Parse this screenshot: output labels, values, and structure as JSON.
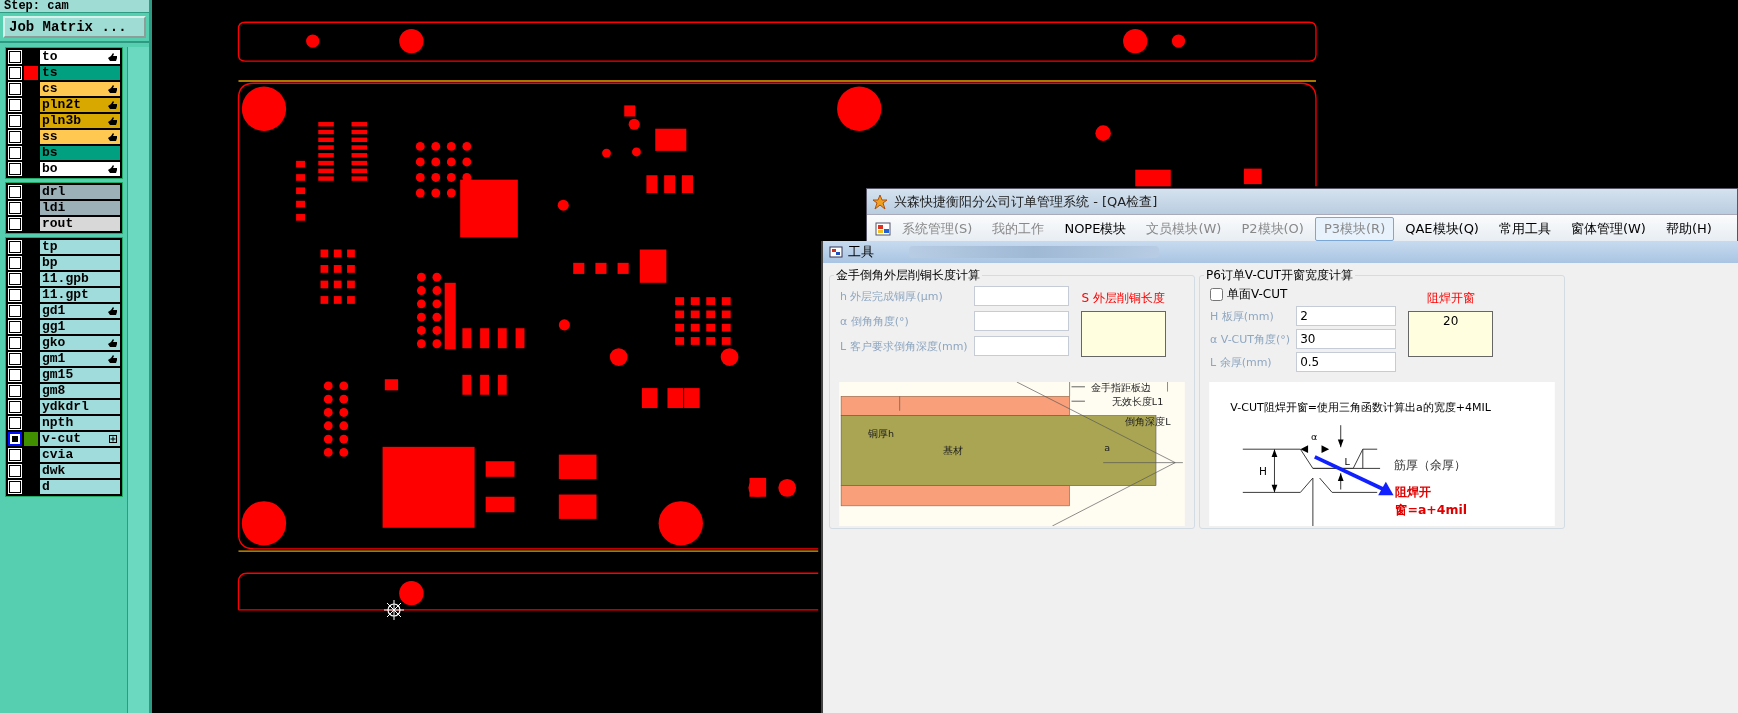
{
  "step_label": "Step: cam",
  "job_matrix_button": "Job Matrix ...",
  "layer_groups": [
    {
      "layers": [
        {
          "name": "to",
          "kind": "silk",
          "hand_mark": true,
          "selected": false
        },
        {
          "name": "ts",
          "kind": "mask",
          "color": "#ff0000",
          "selected": false
        },
        {
          "name": "cs",
          "kind": "copper",
          "hand_mark": true,
          "selected": false
        },
        {
          "name": "pln2t",
          "kind": "plane",
          "hand_mark": true,
          "selected": false
        },
        {
          "name": "pln3b",
          "kind": "plane",
          "hand_mark": true,
          "selected": false
        },
        {
          "name": "ss",
          "kind": "copper",
          "hand_mark": true,
          "selected": false
        },
        {
          "name": "bs",
          "kind": "mask",
          "selected": false
        },
        {
          "name": "bo",
          "kind": "silk",
          "hand_mark": true,
          "selected": false
        }
      ]
    },
    {
      "layers": [
        {
          "name": "drl",
          "kind": "drill",
          "selected": false
        },
        {
          "name": "ldi",
          "kind": "drill",
          "selected": false
        },
        {
          "name": "rout",
          "kind": "rout",
          "selected": false
        }
      ]
    },
    {
      "layers": [
        {
          "name": "tp",
          "kind": "doc",
          "selected": false
        },
        {
          "name": "bp",
          "kind": "doc",
          "selected": false
        },
        {
          "name": "11.gpb",
          "kind": "doc",
          "selected": false
        },
        {
          "name": "11.gpt",
          "kind": "doc",
          "selected": false
        },
        {
          "name": "gd1",
          "kind": "doc",
          "hand_mark": true,
          "selected": false
        },
        {
          "name": "gg1",
          "kind": "doc",
          "selected": false
        },
        {
          "name": "gko",
          "kind": "doc",
          "hand_mark": true,
          "selected": false
        },
        {
          "name": "gm1",
          "kind": "doc",
          "hand_mark": true,
          "selected": false
        },
        {
          "name": "gm15",
          "kind": "doc",
          "selected": false
        },
        {
          "name": "gm8",
          "kind": "doc",
          "selected": false
        },
        {
          "name": "ydkdrl",
          "kind": "doc",
          "selected": false
        },
        {
          "name": "npth",
          "kind": "doc",
          "selected": false
        },
        {
          "name": "v-cut",
          "kind": "doc",
          "color": "#409000",
          "expandable": true,
          "selected": true
        },
        {
          "name": "cvia",
          "kind": "doc",
          "selected": false
        },
        {
          "name": "dwk",
          "kind": "doc",
          "selected": false
        },
        {
          "name": "d",
          "kind": "doc",
          "selected": false
        }
      ]
    }
  ],
  "main_window": {
    "title": "兴森快捷衡阳分公司订单管理系统 - [QA检查]",
    "menu": [
      {
        "label": "系统管理(S)",
        "disabled": true,
        "selected": false
      },
      {
        "label": "我的工作",
        "disabled": true,
        "selected": false
      },
      {
        "label": "NOPE模块",
        "disabled": false,
        "selected": false
      },
      {
        "label": "文员模块(W)",
        "disabled": true,
        "selected": false
      },
      {
        "label": "P2模块(O)",
        "disabled": true,
        "selected": false
      },
      {
        "label": "P3模块(R)",
        "disabled": true,
        "selected": true
      },
      {
        "label": "QAE模块(Q)",
        "disabled": false,
        "selected": false
      },
      {
        "label": "常用工具",
        "disabled": false,
        "selected": false
      },
      {
        "label": "窗体管理(W)",
        "disabled": false,
        "selected": false
      },
      {
        "label": "帮助(H)",
        "disabled": false,
        "selected": false
      }
    ]
  },
  "tool_window": {
    "title": "工具",
    "chamfer_calc": {
      "title": "金手倒角外层削铜长度计算",
      "fields": [
        {
          "label": "h 外层完成铜厚(μm)"
        },
        {
          "label": "α 倒角角度(°)"
        },
        {
          "label": "L 客户要求倒角深度(mm)"
        }
      ],
      "result_label": "S 外层削铜长度",
      "diagram_labels": [
        "金手指距板边",
        "无效长度L1",
        "倒角深度L",
        "铜厚h",
        "基材",
        "a"
      ]
    },
    "vcut_calc": {
      "title": "P6订单V-CUT开窗宽度计算",
      "single_side": {
        "label": "单面V-CUT",
        "checked": false
      },
      "fields": [
        {
          "label": "H 板厚(mm)",
          "value": "2"
        },
        {
          "label": "α V-CUT角度(°)",
          "value": "30"
        },
        {
          "label": "L 余厚(mm)",
          "value": "0.5"
        }
      ],
      "result_label": "阻焊开窗",
      "result_value": "20",
      "formula": "V-CUT阻焊开窗=使用三角函数计算出a的宽度+4MIL",
      "diagram_labels": [
        "α",
        "L",
        "H",
        "筋厚（余厚）",
        "阻焊开",
        "窗=a+4mil"
      ]
    }
  }
}
